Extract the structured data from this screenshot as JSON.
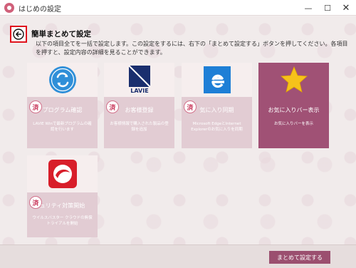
{
  "window": {
    "title": "はじめの設定",
    "minimize_label": "—",
    "maximize_label": "☐",
    "close_label": "✕"
  },
  "header": {
    "page_title": "簡単まとめて設定",
    "description": "以下の項目全てを一括で設定します。この設定をするには、右下の「まとめて設定する」ボタンを押してください。各項目を押すと、設定内容の詳細を見ることができます。"
  },
  "cards": [
    {
      "label": "プログラム確認",
      "sub": "LAVIE Winで最新プログラムの確認を行います",
      "stamp": "済",
      "icon": "sync-circle-icon",
      "active": false
    },
    {
      "label": "お客様登録",
      "sub": "お客様情報で購入された製品の登録を追加",
      "stamp": "済",
      "icon": "lavie-logo-icon",
      "active": false
    },
    {
      "label": "気に入り同期",
      "sub": "Microsoft EdgeとInternet Explorerのお気に入りを同期",
      "stamp": "済",
      "icon": "edge-browser-icon",
      "active": false
    },
    {
      "label": "お気に入りバー表示",
      "sub": "お気に入りバーを表示",
      "stamp": "",
      "icon": "star-icon",
      "active": true
    },
    {
      "label": "ュリティ対策開始",
      "sub": "ウイルスバスター クラウドの無償トライアルを開始",
      "stamp": "済",
      "icon": "trend-micro-icon",
      "active": false
    }
  ],
  "footer": {
    "primary_button": "まとめて設定する"
  },
  "colors": {
    "accent": "#9b4f6f",
    "card_bottom": "#e2ccd3",
    "back_highlight": "#e0141e"
  }
}
